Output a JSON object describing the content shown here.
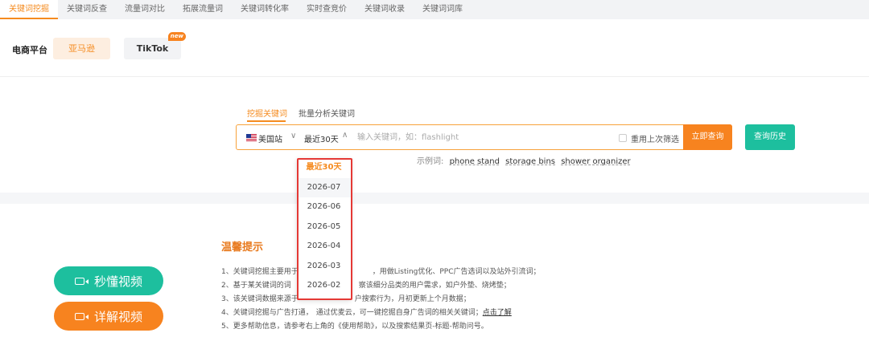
{
  "tabs": [
    "关键词挖掘",
    "关键词反查",
    "流量词对比",
    "拓展流量词",
    "关键词转化率",
    "实时查竞价",
    "关键词收录",
    "关键词词库"
  ],
  "platform": {
    "label": "电商平台",
    "amazon": "亚马逊",
    "tiktok": "TikTok",
    "new_badge": "new"
  },
  "subtabs": {
    "mine": "挖掘关键词",
    "batch": "批量分析关键词"
  },
  "search": {
    "site": "美国站",
    "period": "最近30天",
    "placeholder": "输入关键词，如：flashlight",
    "reuse_label": "重用上次筛选",
    "query_button": "立即查询",
    "history_button": "查询历史"
  },
  "examples": {
    "label": "示例词:",
    "items": [
      "phone stand",
      "storage bins",
      "shower organizer"
    ]
  },
  "dropdown": {
    "options": [
      "最近30天",
      "2026-07",
      "2026-06",
      "2026-05",
      "2026-04",
      "2026-03",
      "2026-02"
    ]
  },
  "tips": {
    "title": "温馨提示",
    "lines": [
      "1、关键词挖掘主要用于",
      "2、基于某关键词的词",
      "3、该关键词数据来源于",
      "4、关键词挖掘与广告打通，",
      "5、更多帮助信息，请参考右上角的《使用帮助》，以及搜索结果页-标题-帮助问号。"
    ],
    "line1_tail": "，用做Listing优化、PPC广告选词以及站外引流词；",
    "line2_tail": "察该细分品类的用户需求，如户外垫、烧烤垫；",
    "line3_tail": "户搜索行为，月初更新上个月数据；",
    "line4_tail": "可一键挖掘自身广告词的相关关键词；",
    "line4_link": "点击了解",
    "line4_mid": "通过优麦云，"
  },
  "videos": {
    "quick": "秒懂视频",
    "detail": "详解视频"
  },
  "colors": {
    "accent": "#f7831f",
    "teal": "#1dbf9e",
    "highlight": "#e53935"
  }
}
